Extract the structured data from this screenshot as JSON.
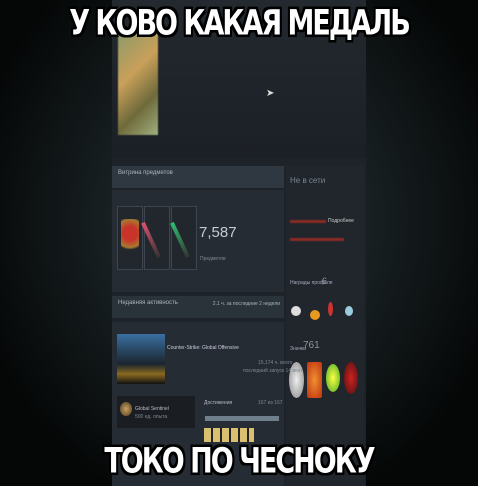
{
  "captions": {
    "top": "У КОВО КАКАЯ МЕДАЛЬ",
    "bottom": "ТОКО ПО ЧЕСНОКУ"
  },
  "showcase": {
    "title": "Витрина предметов",
    "count": "7,587",
    "count_label": "Предметов"
  },
  "status": {
    "state": "Не в сети",
    "details_link": "Подробнее"
  },
  "awards": {
    "label": "Награды профиля",
    "count": "6"
  },
  "activity": {
    "title": "Недавняя активность",
    "hours": "2.1 ч. за последние 2 недели"
  },
  "game": {
    "name": "Counter-Strike: Global Offensive",
    "total": "15,174 ч. всего",
    "last": "последний запуск 14 июл"
  },
  "badge": {
    "name": "Global Sentinel",
    "xp": "500 ед. опыта"
  },
  "achievements": {
    "label": "Достижения",
    "progress": "167 из 167",
    "fraction": 1.0
  },
  "badges": {
    "label": "Значки",
    "count": "761"
  }
}
